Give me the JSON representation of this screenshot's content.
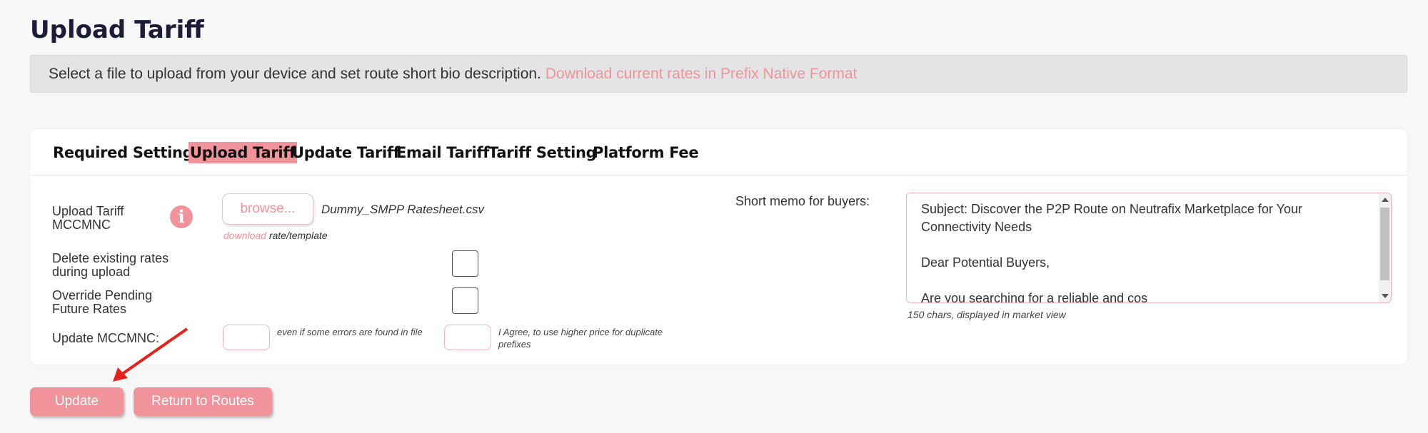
{
  "page": {
    "title": "Upload Tariff"
  },
  "info_bar": {
    "text": "Select a file to upload from your device and set route short bio description.",
    "link": "Download current rates in Prefix Native Format"
  },
  "tabs": [
    {
      "label": "Required Settings",
      "active": false
    },
    {
      "label": "Upload Tariff",
      "active": true
    },
    {
      "label": "Update Tariff",
      "active": false
    },
    {
      "label": "Email Tariff",
      "active": false
    },
    {
      "label": "Tariff Setting",
      "active": false
    },
    {
      "label": "Platform Fee",
      "active": false
    }
  ],
  "form": {
    "upload_label_line1": "Upload Tariff",
    "upload_label_line2": "MCCMNC",
    "info_icon_glyph": "i",
    "browse_label": "browse...",
    "file_name": "Dummy_SMPP Ratesheet.csv",
    "template_link": "download",
    "template_text": "rate/template",
    "delete_label_line1": "Delete existing rates",
    "delete_label_line2": "during upload",
    "override_label_line1": "Override Pending",
    "override_label_line2": "Future Rates",
    "update_mccmnc_label": "Update MCCMNC:",
    "errors_note": "even if some errors are found in file",
    "agree_note_line1": "I Agree, to use higher price for duplicate",
    "agree_note_line2": "prefixes"
  },
  "memo": {
    "label": "Short memo for buyers:",
    "text": "Subject: Discover the P2P Route on Neutrafix Marketplace for Your Connectivity Needs\n\nDear Potential Buyers,\n\nAre you searching for a reliable and cos",
    "hint": "150 chars, displayed in market view"
  },
  "buttons": {
    "update": "Update",
    "return": "Return to Routes"
  },
  "colors": {
    "accent": "#f0939a",
    "annotation_arrow": "#e8201c"
  }
}
